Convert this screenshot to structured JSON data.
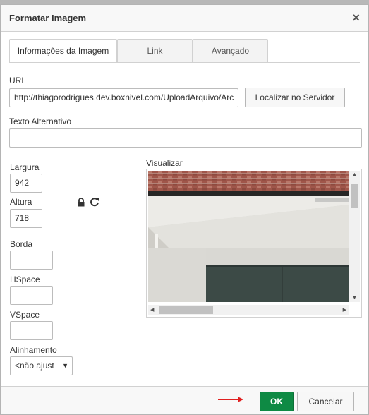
{
  "dialog": {
    "title": "Formatar Imagem",
    "close_label": "×"
  },
  "tabs": [
    {
      "label": "Informações da Imagem",
      "active": true
    },
    {
      "label": "Link",
      "active": false
    },
    {
      "label": "Avançado",
      "active": false
    }
  ],
  "url": {
    "label": "URL",
    "value": "http://thiagorodrigues.dev.boxnivel.com/UploadArquivo/Arc",
    "browse_button": "Localizar no Servidor"
  },
  "alt_text": {
    "label": "Texto Alternativo",
    "value": ""
  },
  "width": {
    "label": "Largura",
    "value": "942"
  },
  "height": {
    "label": "Altura",
    "value": "718"
  },
  "border": {
    "label": "Borda",
    "value": ""
  },
  "hspace": {
    "label": "HSpace",
    "value": ""
  },
  "vspace": {
    "label": "VSpace",
    "value": ""
  },
  "alignment": {
    "label": "Alinhamento",
    "selected": "<não ajust"
  },
  "preview": {
    "label": "Visualizar"
  },
  "footer": {
    "ok_label": "OK",
    "cancel_label": "Cancelar"
  },
  "colors": {
    "ok_button": "#0e8a44",
    "arrow": "#e02020",
    "brick": "#a0564a"
  },
  "icons": [
    "lock-icon",
    "reset-icon",
    "close-icon",
    "arrow-pointer-icon"
  ]
}
